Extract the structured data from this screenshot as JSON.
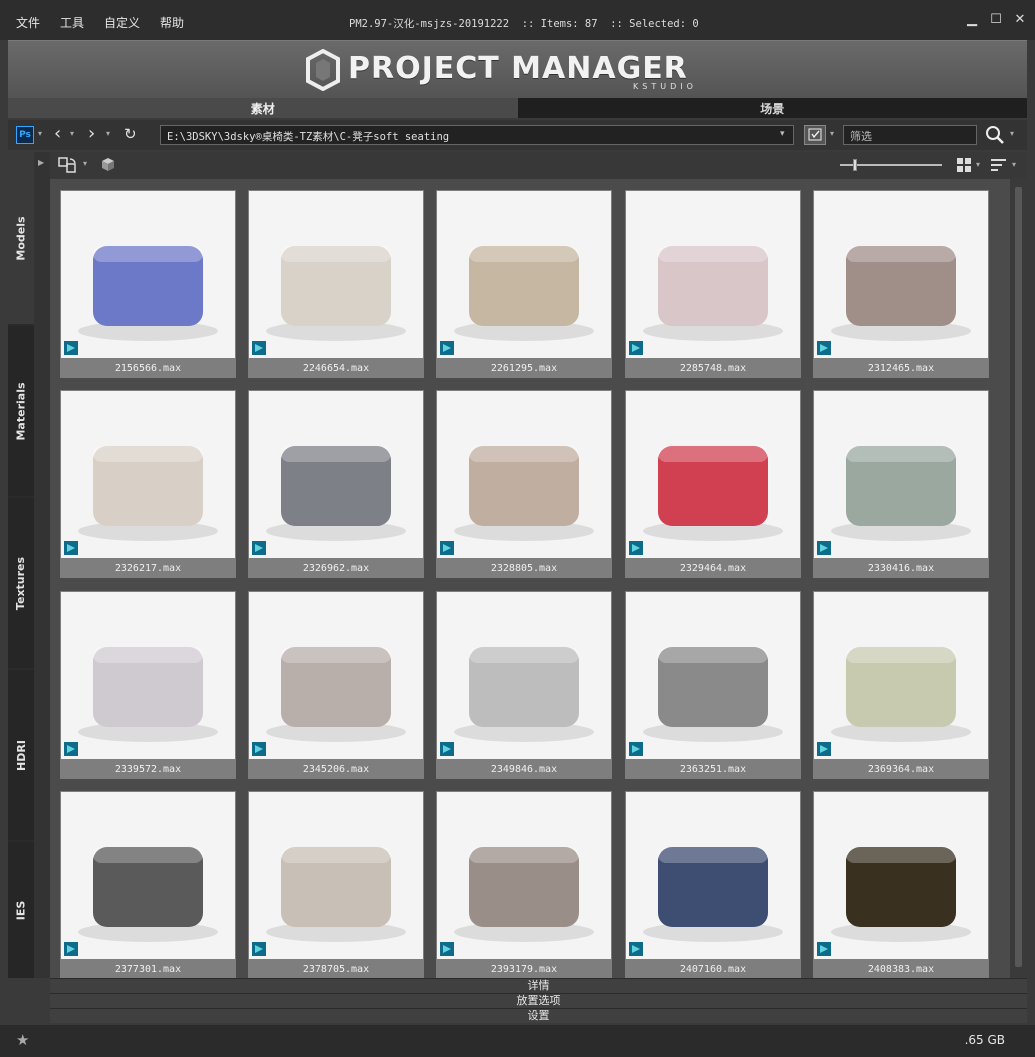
{
  "menu": [
    "文件",
    "工具",
    "自定义",
    "帮助"
  ],
  "window": {
    "title": "PM2.97-汉化-msjzs-20191222  :: Items: 87  :: Selected: 0"
  },
  "banner": {
    "logo_text": "PROJECT MANAGER",
    "logo_sub": "KSTUDIO"
  },
  "tabs": [
    {
      "label": "素材",
      "active": true
    },
    {
      "label": "场景",
      "active": false
    }
  ],
  "pathbar": {
    "ps_label": "Ps",
    "path": "E:\\3DSKY\\3dsky®桌椅类-TZ素材\\C-凳子soft seating",
    "filter_placeholder": "筛选"
  },
  "sidebar": [
    "Models",
    "Materials",
    "Textures",
    "HDRI",
    "IES"
  ],
  "viewbar": {
    "thumb_size_fraction": 0.15
  },
  "grid": {
    "items": [
      {
        "name": "2156566.max",
        "bg": "#6c78c8"
      },
      {
        "name": "2246654.max",
        "bg": "#d9d2c8"
      },
      {
        "name": "2261295.max",
        "bg": "#c6b7a2"
      },
      {
        "name": "2285748.max",
        "bg": "#d8c6c8"
      },
      {
        "name": "2312465.max",
        "bg": "#a08e88"
      },
      {
        "name": "2326217.max",
        "bg": "#d8d0c6"
      },
      {
        "name": "2326962.max",
        "bg": "#7e8088"
      },
      {
        "name": "2328805.max",
        "bg": "#c0aea0"
      },
      {
        "name": "2329464.max",
        "bg": "#d04050"
      },
      {
        "name": "2330416.max",
        "bg": "#9aa8a0"
      },
      {
        "name": "2339572.max",
        "bg": "#cfcad0"
      },
      {
        "name": "2345206.max",
        "bg": "#b8aeaa"
      },
      {
        "name": "2349846.max",
        "bg": "#bdbdbd"
      },
      {
        "name": "2363251.max",
        "bg": "#8a8a8a"
      },
      {
        "name": "2369364.max",
        "bg": "#c8cab0"
      },
      {
        "name": "2377301.max",
        "bg": "#5a5a5a"
      },
      {
        "name": "2378705.max",
        "bg": "#c8bfb6"
      },
      {
        "name": "2393179.max",
        "bg": "#9a8e88"
      },
      {
        "name": "2407160.max",
        "bg": "#3e4e72"
      },
      {
        "name": "2408383.max",
        "bg": "#3a3020"
      }
    ]
  },
  "bottom_panels": [
    "详情",
    "放置选项",
    "设置"
  ],
  "status": {
    "disk": ".65 GB"
  }
}
